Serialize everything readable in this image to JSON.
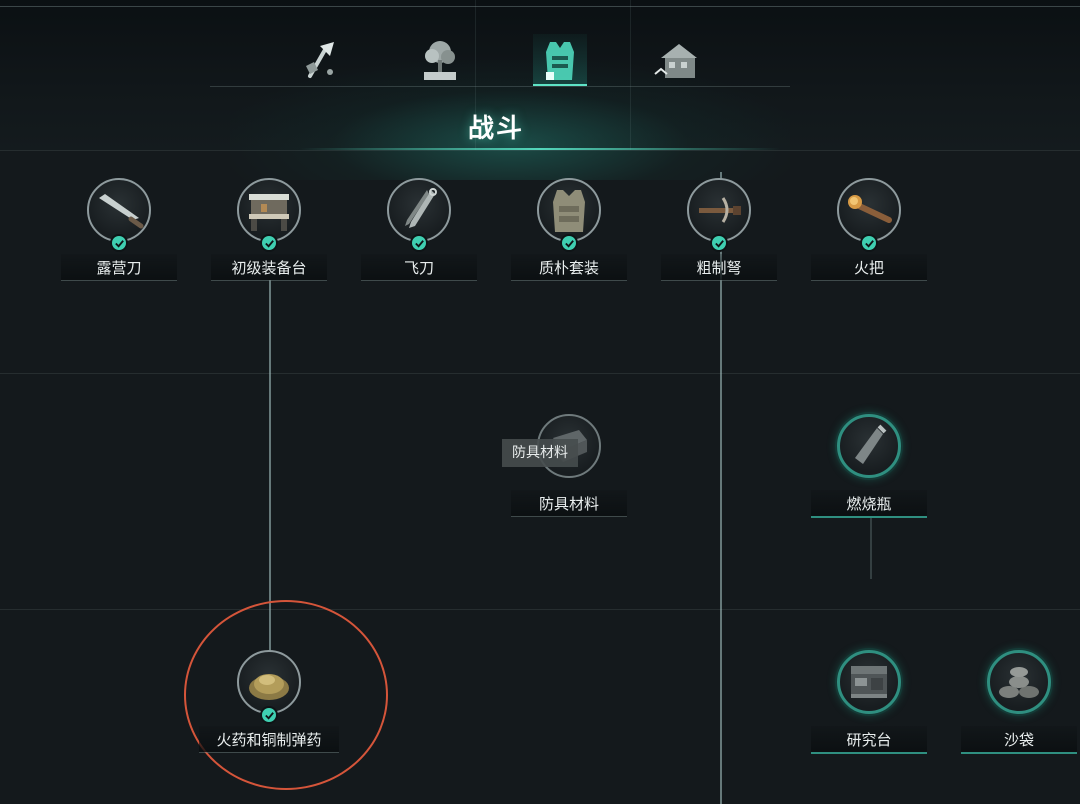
{
  "tabs": [
    {
      "name": "tab-weapons",
      "icon": "axe-icon",
      "active": false
    },
    {
      "name": "tab-planting",
      "icon": "tree-icon",
      "active": false
    },
    {
      "name": "tab-combat",
      "icon": "armor-vest-icon",
      "active": true
    },
    {
      "name": "tab-building",
      "icon": "house-icon",
      "active": false
    }
  ],
  "section": {
    "title": "战斗"
  },
  "nodes": [
    {
      "id": "camp-knife",
      "label": "露营刀",
      "icon": "machete-icon",
      "unlocked": true
    },
    {
      "id": "basic-workbench",
      "label": "初级装备台",
      "icon": "workbench-icon",
      "unlocked": true
    },
    {
      "id": "throwing-knife",
      "label": "飞刀",
      "icon": "throwing-knife-icon",
      "unlocked": true
    },
    {
      "id": "simple-armor",
      "label": "质朴套装",
      "icon": "vest-icon",
      "unlocked": true
    },
    {
      "id": "crude-crossbow",
      "label": "粗制弩",
      "icon": "crossbow-icon",
      "unlocked": true
    },
    {
      "id": "torch",
      "label": "火把",
      "icon": "torch-icon",
      "unlocked": true
    },
    {
      "id": "armor-material",
      "label": "防具材料",
      "icon": "armor-plate-icon",
      "unlocked": false
    },
    {
      "id": "molotov",
      "label": "燃烧瓶",
      "icon": "bottle-icon",
      "unlocked": false
    },
    {
      "id": "gunpowder-ammo",
      "label": "火药和铜制弹药",
      "icon": "gunpowder-icon",
      "unlocked": true
    },
    {
      "id": "research-bench",
      "label": "研究台",
      "icon": "research-bench-icon",
      "unlocked": false
    },
    {
      "id": "sandbag",
      "label": "沙袋",
      "icon": "sandbag-icon",
      "unlocked": false
    }
  ],
  "tooltip": {
    "text": "防具材料"
  },
  "colors": {
    "accent": "#3fcfb1",
    "locked_ring": "#2f8f80",
    "highlight": "#d5553a"
  }
}
